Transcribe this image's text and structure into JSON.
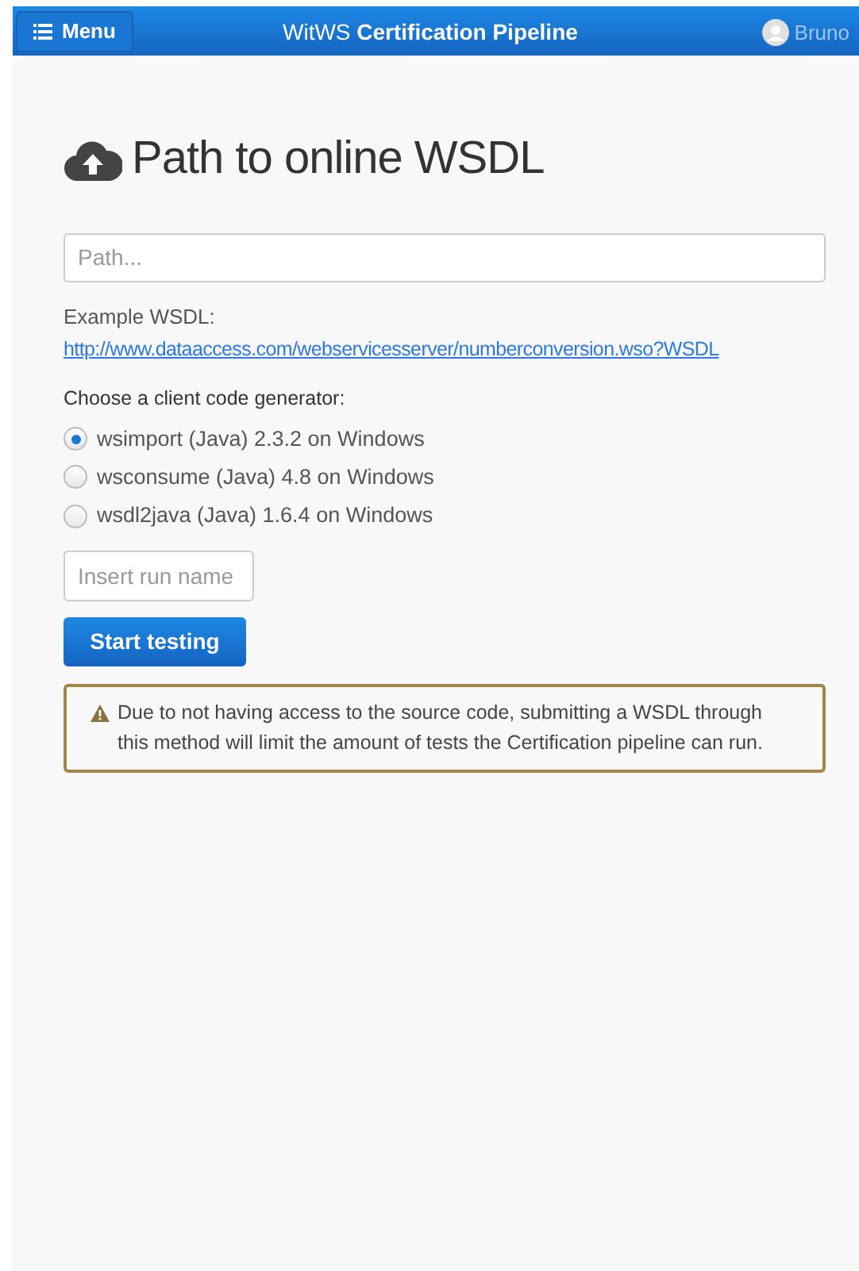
{
  "navbar": {
    "menu_button": "Menu",
    "title": "WitWS **Certification Pipeline**",
    "user": "Bruno"
  },
  "heading": "Path to online WSDL",
  "path_field": {
    "placeholder": "Path..."
  },
  "example": {
    "label": "Example WSDL:",
    "link": "http://www.dataaccess.com/webservicesserver/numberconversion.wso?WSDL"
  },
  "generator": {
    "label": "Choose a client code generator:",
    "options": [
      {
        "label": "wsimport (Java) 2.3.2 on Windows",
        "selected": true
      },
      {
        "label": "wsconsume (Java) 4.8 on Windows",
        "selected": false
      },
      {
        "label": "wsdl2java (Java) 1.6.4 on Windows",
        "selected": false
      }
    ]
  },
  "run_name_field": {
    "placeholder": "Insert run name"
  },
  "start_button": "Start testing",
  "warning": "Due to not having access to the source code, submitting a WSDL through this method will limit the amount of tests the Certification pipeline can run."
}
